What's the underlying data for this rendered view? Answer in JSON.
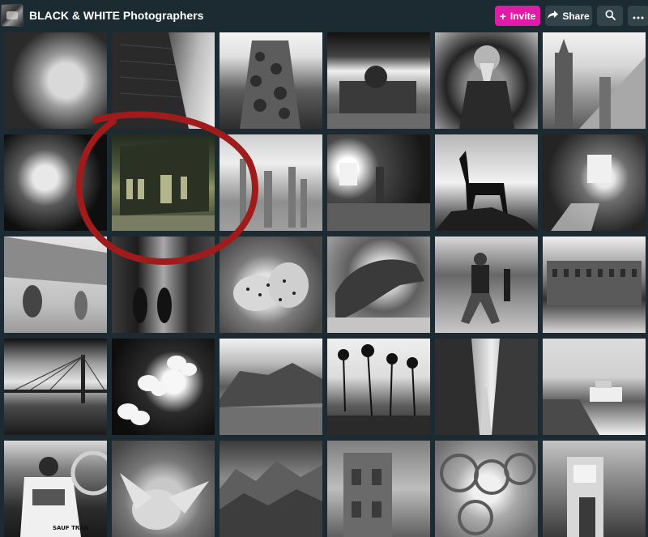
{
  "header": {
    "title": "BLACK & WHITE Photographers",
    "invite_label": "Invite",
    "share_label": "Share",
    "invite_color": "#e11aa8",
    "icons": [
      "plus-icon",
      "share-arrow-icon",
      "search-icon",
      "more-icon"
    ]
  },
  "photos": {
    "count": 30,
    "subjects": [
      "woman-portrait",
      "brick-building",
      "vertical-forest-tower",
      "building-with-clouds",
      "bearded-man",
      "church-towers",
      "feathers",
      "corner-building-night",
      "construction-cranes",
      "cave-window",
      "llama-on-rock",
      "stone-room-light",
      "street-walkers",
      "alley-arches",
      "cheetah-cubs",
      "lizard",
      "running-man",
      "waterfront-palace",
      "cable-bridge",
      "dogwood-flowers",
      "rocky-mountains",
      "palm-trees",
      "narrow-street",
      "pier-boat",
      "shirt-back",
      "pelican",
      "mountain-range",
      "tower-facade",
      "glass-spirals",
      "stone-gate"
    ],
    "shirt_text": "SAUF TRAN",
    "highlight_color": "#a01c1c"
  }
}
